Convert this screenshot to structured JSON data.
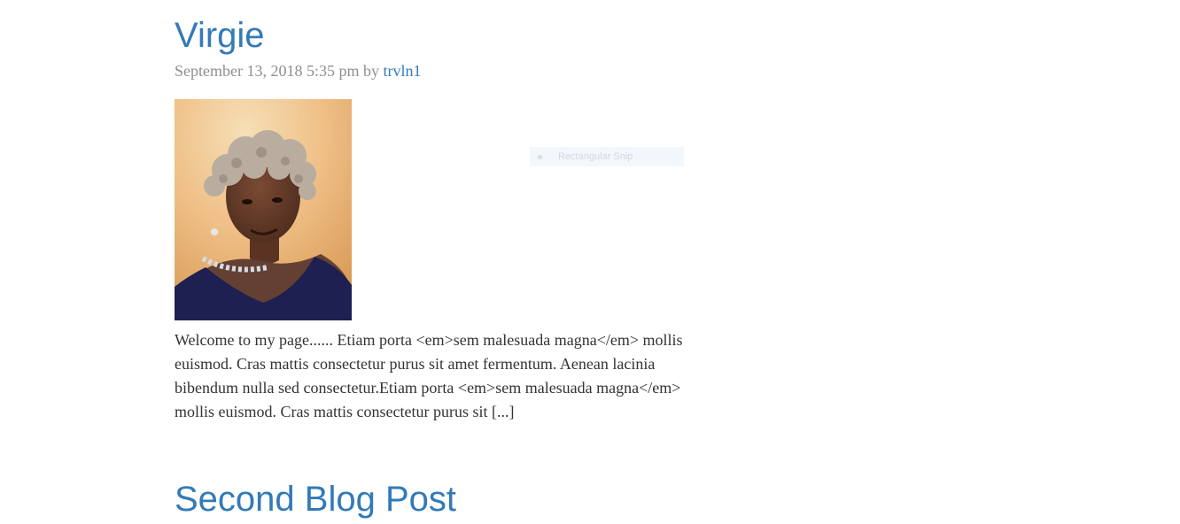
{
  "posts": [
    {
      "title": "Virgie",
      "date": "September 13, 2018 5:35 pm",
      "by": " by ",
      "author": "trvln1",
      "excerpt": "Welcome to my page...... Etiam porta <em>sem malesuada magna</em> mollis euismod. Cras mattis consectetur purus sit amet fermentum. Aenean lacinia bibendum nulla sed consectetur.Etiam porta <em>sem malesuada magna</em> mollis euismod. Cras mattis consectetur purus sit [...]"
    },
    {
      "title": "Second Blog Post"
    }
  ],
  "overlay": {
    "snip_label": "Rectangular Snip"
  },
  "colors": {
    "link": "#337ab7",
    "meta": "#8f8f8f",
    "body_text": "#333333"
  }
}
